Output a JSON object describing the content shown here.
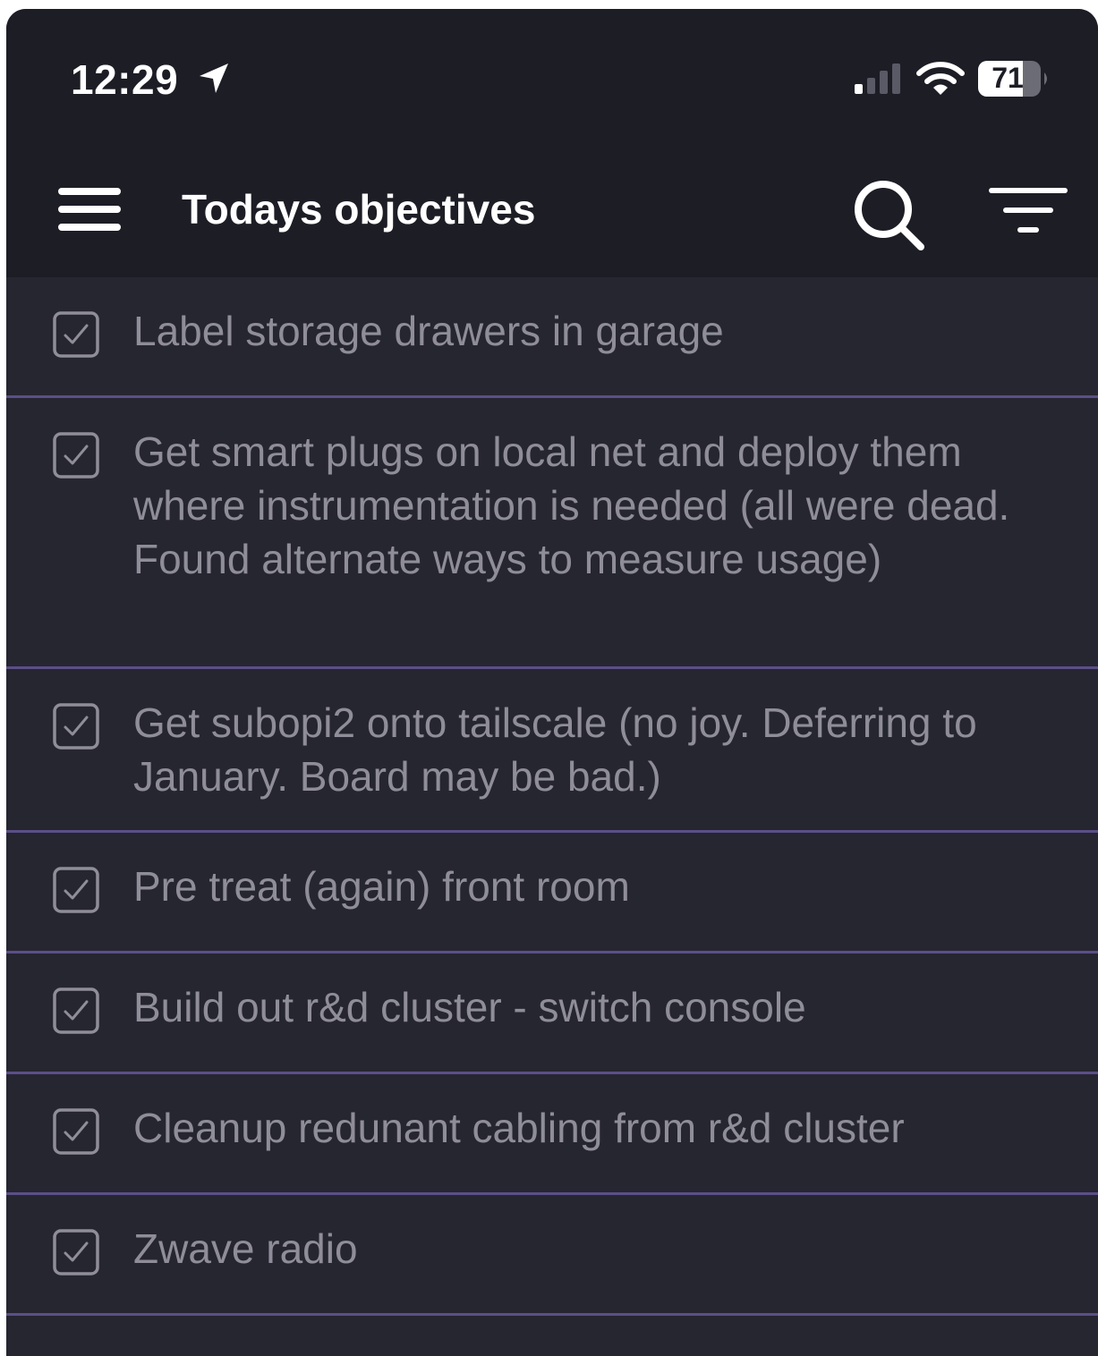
{
  "status_bar": {
    "time": "12:29",
    "battery": "71",
    "icons": [
      "location-arrow-icon",
      "cellular-signal-icon",
      "wifi-icon",
      "battery-icon"
    ]
  },
  "app_bar": {
    "title": "Todays objectives",
    "icons": [
      "menu-icon",
      "search-icon",
      "filter-icon"
    ]
  },
  "tasks": [
    {
      "label": "Label storage drawers in garage",
      "checked": true
    },
    {
      "label": "Get smart plugs on local net and deploy them where instrumentation is needed (all were dead. Found alternate ways to measure usage)",
      "checked": true
    },
    {
      "label": "Get subopi2 onto tailscale (no joy. Deferring to January. Board may be bad.)",
      "checked": true
    },
    {
      "label": "Pre treat (again) front room",
      "checked": true
    },
    {
      "label": "Build out r&d cluster - switch console",
      "checked": true
    },
    {
      "label": "Cleanup redunant cabling from r&d cluster",
      "checked": true
    },
    {
      "label": "Zwave radio",
      "checked": true
    }
  ],
  "colors": {
    "header_bg": "#1d1d26",
    "list_bg": "#262631",
    "divider": "#5c4f88",
    "text_muted": "#8f8e98",
    "title_text": "#ffffff"
  }
}
